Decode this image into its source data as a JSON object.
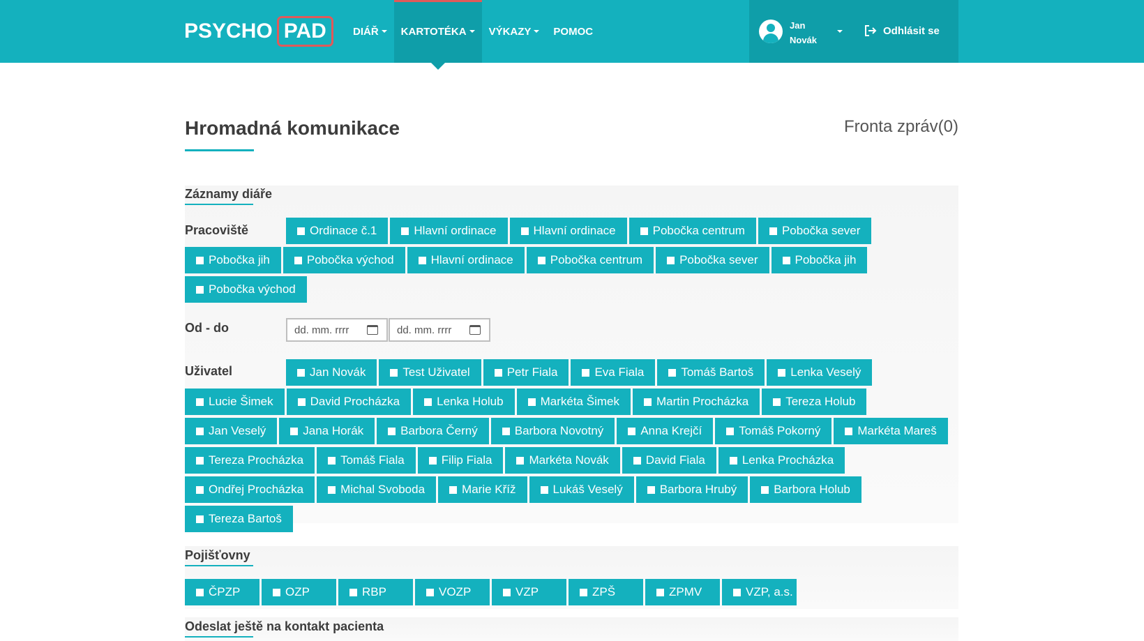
{
  "header": {
    "logo_left": "PSYCHO",
    "logo_right": "PAD",
    "nav": [
      {
        "label": "DIÁŘ",
        "active": false
      },
      {
        "label": "KARTOTÉKA",
        "active": true
      },
      {
        "label": "VÝKAZY",
        "active": false
      },
      {
        "label": "POMOC",
        "active": false
      }
    ],
    "user": {
      "first": "Jan",
      "last": "Novák"
    },
    "logout_label": "Odhlásit se",
    "colors": {
      "bar": "#14b1be",
      "active": "#0f9ea9",
      "accent": "#e05a5a"
    }
  },
  "page": {
    "title": "Hromadná komunikace",
    "queue_label": "Fronta zpráv(0)"
  },
  "diary": {
    "title": "Záznamy diáře",
    "workplace_label": "Pracoviště",
    "workplaces": [
      "Ordinace č.1",
      "Hlavní ordinace",
      "Hlavní ordinace",
      "Pobočka centrum",
      "Pobočka sever",
      "Pobočka jih",
      "Pobočka východ",
      "Hlavní ordinace",
      "Pobočka centrum",
      "Pobočka sever",
      "Pobočka jih",
      "Pobočka východ"
    ],
    "date_label": "Od - do",
    "date_from_placeholder": "dd. mm. rrrr",
    "date_to_placeholder": "dd. mm. rrrr",
    "user_label": "Uživatel",
    "users": [
      "Jan Novák",
      "Test Uživatel",
      "Petr Fiala",
      "Eva Fiala",
      "Tomáš Bartoš",
      "Lenka Veselý",
      "Lucie Šimek",
      "David Procházka",
      "Lenka Holub",
      "Markéta Šimek",
      "Martin Procházka",
      "Tereza Holub",
      "Jan Veselý",
      "Jana Horák",
      "Barbora Černý",
      "Barbora Novotný",
      "Anna Krejčí",
      "Tomáš Pokorný",
      "Markéta Mareš",
      "Tereza Procházka",
      "Tomáš Fiala",
      "Filip Fiala",
      "Markéta Novák",
      "David Fiala",
      "Lenka Procházka",
      "Ondřej Procházka",
      "Michal Svoboda",
      "Marie Kříž",
      "Lukáš Veselý",
      "Barbora Hrubý",
      "Barbora Holub",
      "Tereza Bartoš"
    ]
  },
  "insurance": {
    "title": "Pojišťovny",
    "items": [
      "ČPZP",
      "OZP",
      "RBP",
      "VOZP",
      "VZP",
      "ZPŠ",
      "ZPMV",
      "VZP, a.s."
    ]
  },
  "contact": {
    "title": "Odeslat ještě na kontakt pacienta"
  }
}
